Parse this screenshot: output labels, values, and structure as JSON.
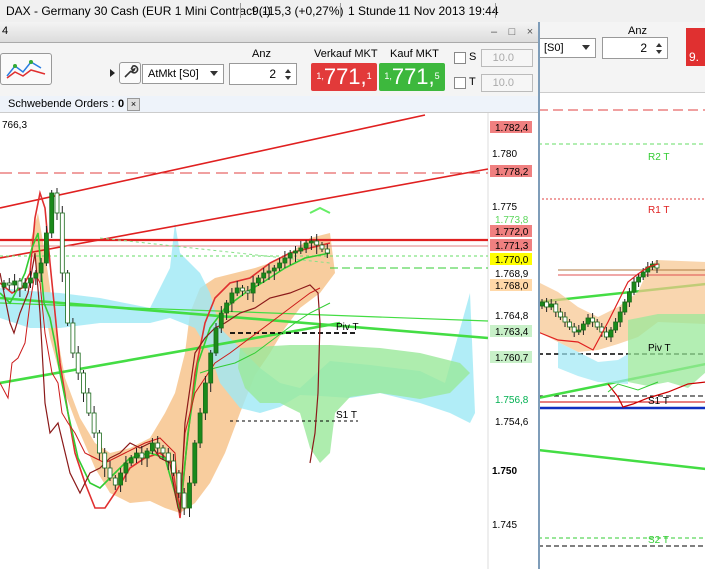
{
  "titlebar": {
    "app_title": "DAX - Germany 30 Cash (EUR 1 Mini Contract (-)",
    "price_change": "9.115,3 (+0,27%)",
    "timeframe": "1 Stunde",
    "datetime": "11 Nov 2013 19:44"
  },
  "front_window": {
    "title_fragment": "4",
    "minimize_glyph": "–",
    "restore_glyph": "□",
    "close_glyph": "×",
    "order_type": "AtMkt [S0]",
    "qty_label": "Anz",
    "qty_value": "2",
    "sell_label": "Verkauf MKT",
    "sell_prefix": "1,",
    "sell_main": "771,",
    "sell_suffix": "1",
    "buy_label": "Kauf MKT",
    "buy_prefix": "1,",
    "buy_main": "771,",
    "buy_suffix": "5",
    "stop_label": "S",
    "stop_value": "10.0",
    "target_label": "T",
    "target_value": "10.0",
    "pending_orders_label": "Schwebende Orders :",
    "pending_orders_count": "0",
    "top_left_value": "766,3"
  },
  "back_window": {
    "order_type": "[S0]",
    "qty_label": "Anz",
    "qty_value": "2",
    "sell_fragment": "9."
  },
  "chart_data": {
    "type": "line",
    "title": "",
    "price_scale_labels": [
      "1.780",
      "1.775",
      "1.750",
      "1.745"
    ],
    "price_boxes": [
      {
        "value": "1.782,4",
        "bg": "#f08080"
      },
      {
        "value": "1.778,2",
        "bg": "#f08080"
      },
      {
        "value": "1.773,8",
        "bg": "#ffffff",
        "fg": "#5cd65c"
      },
      {
        "value": "1.772,0",
        "bg": "#f08080"
      },
      {
        "value": "1.771,3",
        "bg": "#f08080"
      },
      {
        "value": "1.770,0",
        "bg": "#ffff00"
      },
      {
        "value": "1.768,9",
        "bg": "#ffffff",
        "fg": "#000000"
      },
      {
        "value": "1.768,0",
        "bg": "#ffd8a8"
      },
      {
        "value": "1.764,8",
        "bg": "#ffffff",
        "fg": "#000000"
      },
      {
        "value": "1.763,4",
        "bg": "#c8f0c8"
      },
      {
        "value": "1.760,7",
        "bg": "#c8f0c8"
      },
      {
        "value": "1.756,8",
        "bg": "#ffffff",
        "fg": "#00b050"
      },
      {
        "value": "1.754,6",
        "bg": "#ffffff",
        "fg": "#000000"
      }
    ],
    "level_labels": [
      {
        "text": "Piv T",
        "window": "front"
      },
      {
        "text": "S1 T",
        "window": "front"
      },
      {
        "text": "R2 T",
        "window": "back"
      },
      {
        "text": "R1 T",
        "window": "back"
      },
      {
        "text": "Piv T",
        "window": "back"
      },
      {
        "text": "S1 T",
        "window": "back"
      },
      {
        "text": "S2 T",
        "window": "back"
      }
    ],
    "ylim": [
      1743,
      1785
    ],
    "colors": {
      "candle": "#1a8a1a",
      "cloud_orange": "#f7c48d",
      "cloud_cyan": "#9ee8f5",
      "cloud_green": "#9ae89a",
      "red_line": "#e02020",
      "green_line": "#33cc33",
      "ma_dark_red": "#8b1a1a"
    }
  }
}
